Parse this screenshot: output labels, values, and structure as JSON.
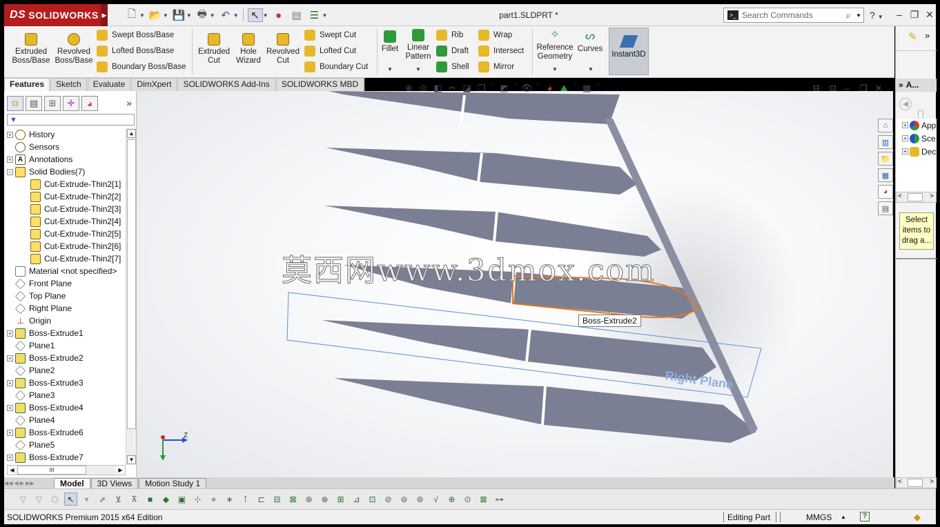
{
  "app": {
    "logo_text": "SOLIDWORKS",
    "document_title": "part1.SLDPRT *",
    "search_placeholder": "Search Commands",
    "help_label": "?"
  },
  "ribbon": {
    "features_left": [
      {
        "label_line1": "Extruded",
        "label_line2": "Boss/Base",
        "color": "#e7b82a"
      },
      {
        "label_line1": "Revolved",
        "label_line2": "Boss/Base",
        "color": "#e7b82a"
      }
    ],
    "boss_small": [
      {
        "label": "Swept Boss/Base",
        "color": "#e7b82a"
      },
      {
        "label": "Lofted Boss/Base",
        "color": "#e7b82a"
      },
      {
        "label": "Boundary Boss/Base",
        "color": "#e7b82a"
      }
    ],
    "cut_big": [
      {
        "label_line1": "Extruded",
        "label_line2": "Cut",
        "color": "#e7b82a"
      },
      {
        "label_line1": "Hole",
        "label_line2": "Wizard",
        "color": "#e7b82a"
      },
      {
        "label_line1": "Revolved",
        "label_line2": "Cut",
        "color": "#e7b82a"
      }
    ],
    "cut_small": [
      {
        "label": "Swept Cut",
        "color": "#e7b82a"
      },
      {
        "label": "Lofted Cut",
        "color": "#e7b82a"
      },
      {
        "label": "Boundary Cut",
        "color": "#e7b82a"
      }
    ],
    "fillet_label": "Fillet",
    "linear_pattern_line1": "Linear",
    "linear_pattern_line2": "Pattern",
    "misc_col1": [
      {
        "label": "Rib",
        "color": "#e7b82a"
      },
      {
        "label": "Draft",
        "color": "#2e9a3a"
      },
      {
        "label": "Shell",
        "color": "#2e9a3a"
      }
    ],
    "misc_col2": [
      {
        "label": "Wrap",
        "color": "#e7b82a"
      },
      {
        "label": "Intersect",
        "color": "#e7b82a"
      },
      {
        "label": "Mirror",
        "color": "#e7b82a"
      }
    ],
    "reference_geometry_line1": "Reference",
    "reference_geometry_line2": "Geometry",
    "curves_label": "Curves",
    "instant3d_label": "Instant3D"
  },
  "command_tabs": [
    {
      "label": "Features",
      "active": true
    },
    {
      "label": "Sketch",
      "active": false
    },
    {
      "label": "Evaluate",
      "active": false
    },
    {
      "label": "DimXpert",
      "active": false
    },
    {
      "label": "SOLIDWORKS Add-Ins",
      "active": false
    },
    {
      "label": "SOLIDWORKS MBD",
      "active": false
    }
  ],
  "feature_tree": [
    {
      "label": "History",
      "icon": "history-icon",
      "expander": "+"
    },
    {
      "label": "Sensors",
      "icon": "sensor-icon",
      "expander": ""
    },
    {
      "label": "Annotations",
      "icon": "annotation-icon",
      "expander": "+"
    },
    {
      "label": "Solid Bodies(7)",
      "icon": "solid-bodies-icon",
      "expander": "-"
    },
    {
      "label": "Cut-Extrude-Thin2[1]",
      "icon": "body-icon",
      "expander": "",
      "indent": 1
    },
    {
      "label": "Cut-Extrude-Thin2[2]",
      "icon": "body-icon",
      "expander": "",
      "indent": 1
    },
    {
      "label": "Cut-Extrude-Thin2[3]",
      "icon": "body-icon",
      "expander": "",
      "indent": 1
    },
    {
      "label": "Cut-Extrude-Thin2[4]",
      "icon": "body-icon",
      "expander": "",
      "indent": 1
    },
    {
      "label": "Cut-Extrude-Thin2[5]",
      "icon": "body-icon",
      "expander": "",
      "indent": 1
    },
    {
      "label": "Cut-Extrude-Thin2[6]",
      "icon": "body-icon",
      "expander": "",
      "indent": 1
    },
    {
      "label": "Cut-Extrude-Thin2[7]",
      "icon": "body-icon",
      "expander": "",
      "indent": 1
    },
    {
      "label": "Material <not specified>",
      "icon": "material-icon",
      "expander": ""
    },
    {
      "label": "Front Plane",
      "icon": "plane-icon",
      "expander": ""
    },
    {
      "label": "Top Plane",
      "icon": "plane-icon",
      "expander": ""
    },
    {
      "label": "Right Plane",
      "icon": "plane-icon",
      "expander": ""
    },
    {
      "label": "Origin",
      "icon": "origin-icon",
      "expander": ""
    },
    {
      "label": "Boss-Extrude1",
      "icon": "extrude-icon",
      "expander": "+"
    },
    {
      "label": "Plane1",
      "icon": "plane-icon",
      "expander": ""
    },
    {
      "label": "Boss-Extrude2",
      "icon": "extrude-icon",
      "expander": "+"
    },
    {
      "label": "Plane2",
      "icon": "plane-icon",
      "expander": ""
    },
    {
      "label": "Boss-Extrude3",
      "icon": "extrude-icon",
      "expander": "+"
    },
    {
      "label": "Plane3",
      "icon": "plane-icon",
      "expander": ""
    },
    {
      "label": "Boss-Extrude4",
      "icon": "extrude-icon",
      "expander": "+"
    },
    {
      "label": "Plane4",
      "icon": "plane-icon",
      "expander": ""
    },
    {
      "label": "Boss-Extrude6",
      "icon": "extrude-icon",
      "expander": "+"
    },
    {
      "label": "Plane5",
      "icon": "plane-icon",
      "expander": ""
    },
    {
      "label": "Boss-Extrude7",
      "icon": "extrude-icon",
      "expander": "+"
    }
  ],
  "viewport": {
    "watermark": "莫西网www.3dmox.com",
    "tooltip": "Boss-Extrude2",
    "plane_label": "Right Plane",
    "triad_axis_z": "Z",
    "model_color": "#7b7f93",
    "highlight_color": "#e07a1a",
    "plane_color": "#5b8fd6"
  },
  "right_pane": {
    "header": "A...",
    "tree": [
      {
        "label": "App",
        "color": "#d23b2b"
      },
      {
        "label": "Sce",
        "color": "#2e9a3a"
      },
      {
        "label": "Dec",
        "color": "#e7b82a"
      }
    ],
    "tip": "Select items to drag a..."
  },
  "bottom_tabs": [
    {
      "label": "Model",
      "active": true
    },
    {
      "label": "3D Views",
      "active": false
    },
    {
      "label": "Motion Study 1",
      "active": false
    }
  ],
  "status": {
    "edition": "SOLIDWORKS Premium 2015 x64 Edition",
    "editing": "Editing Part",
    "units": "MMGS",
    "help": "?"
  }
}
